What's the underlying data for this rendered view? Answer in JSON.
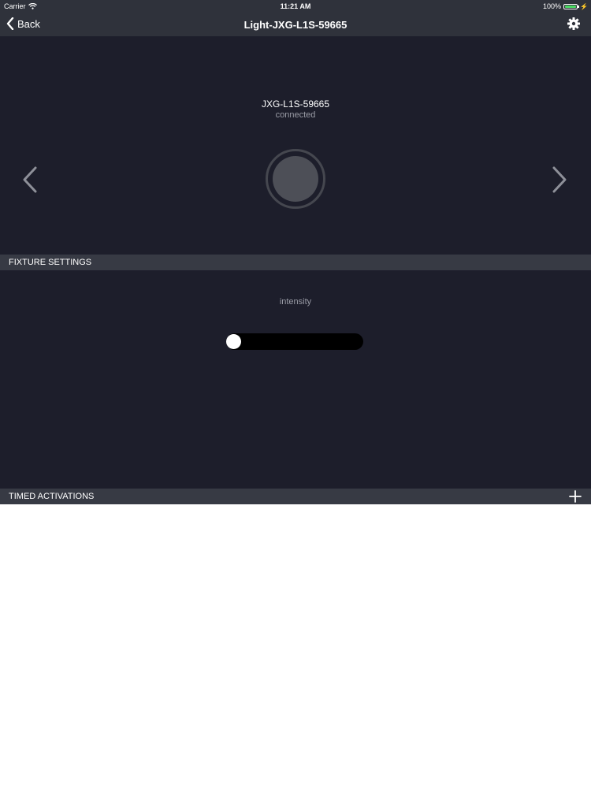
{
  "status_bar": {
    "carrier": "Carrier",
    "time": "11:21 AM",
    "battery": "100%",
    "battery_level": 1.0,
    "battery_color": "#4cd964"
  },
  "nav": {
    "back_label": "Back",
    "title": "Light-JXG-L1S-59665"
  },
  "device": {
    "name": "JXG-L1S-59665",
    "status": "connected"
  },
  "fixture_settings": {
    "header": "FIXTURE SETTINGS",
    "intensity_label": "intensity",
    "intensity_value": 0.0
  },
  "timed_activations": {
    "header": "TIMED ACTIVATIONS"
  },
  "colors": {
    "bar": "#2f323b",
    "panel": "#1d1e2b",
    "section_header": "#373a44",
    "slider_track": "#000000"
  },
  "icons": {
    "wifi": "wifi-icon",
    "back": "chevron-left-icon",
    "settings": "gear-icon",
    "previous": "chevron-left-icon",
    "next": "chevron-right-icon",
    "add": "plus-icon",
    "power": "power-button-icon"
  }
}
